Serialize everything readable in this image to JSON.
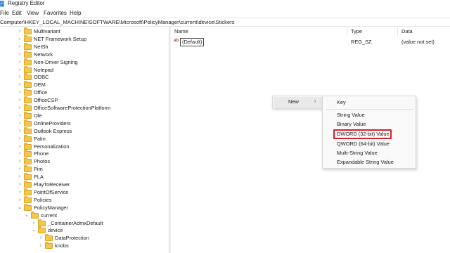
{
  "app": {
    "title": "Registry Editor"
  },
  "menu": [
    "File",
    "Edit",
    "View",
    "Favorites",
    "Help"
  ],
  "address": "Computer\\HKEY_LOCAL_MACHINE\\SOFTWARE\\Microsoft\\PolicyManager\\current\\device\\Stickers",
  "tree": [
    {
      "label": "Multivariant",
      "expanded": false
    },
    {
      "label": "NET Framework Setup",
      "expanded": false
    },
    {
      "label": "NetSh",
      "expanded": false
    },
    {
      "label": "Network",
      "expanded": false
    },
    {
      "label": "Non-Driver Signing",
      "expanded": false
    },
    {
      "label": "Notepad",
      "expanded": false
    },
    {
      "label": "ODBC",
      "expanded": false
    },
    {
      "label": "OEM",
      "expanded": false
    },
    {
      "label": "Office",
      "expanded": false
    },
    {
      "label": "OfficeCSP",
      "expanded": false
    },
    {
      "label": "OfficeSoftwareProtectionPlatform",
      "expanded": false
    },
    {
      "label": "Ole",
      "expanded": false
    },
    {
      "label": "OnlineProviders",
      "expanded": false
    },
    {
      "label": "Outlook Express",
      "expanded": false
    },
    {
      "label": "Palm",
      "expanded": false
    },
    {
      "label": "Personalization",
      "expanded": false
    },
    {
      "label": "Phone",
      "expanded": false
    },
    {
      "label": "Photos",
      "expanded": false
    },
    {
      "label": "Pim",
      "expanded": false
    },
    {
      "label": "PLA",
      "expanded": false
    },
    {
      "label": "PlayToReceiver",
      "expanded": false
    },
    {
      "label": "PointOfService",
      "expanded": false
    },
    {
      "label": "Policies",
      "expanded": false
    },
    {
      "label": "PolicyManager",
      "expanded": true
    },
    {
      "label": "current",
      "expanded": true
    },
    {
      "label": "_ContainerAdmxDefault",
      "expanded": false
    },
    {
      "label": "device",
      "expanded": true
    },
    {
      "label": "DataProtection",
      "expanded": false
    },
    {
      "label": "knobs",
      "expanded": false
    }
  ],
  "list": {
    "columns": [
      "Name",
      "Type",
      "Data"
    ],
    "rows": [
      {
        "icon": "ab",
        "name": "(Default)",
        "type": "REG_SZ",
        "data": "(value not set)"
      }
    ]
  },
  "context_menu": {
    "new_label": "New",
    "arrow": "›",
    "submenu": [
      "Key",
      "String Value",
      "Binary Value",
      "DWORD (32-bit) Value",
      "QWORD (64-bit) Value",
      "Multi-String Value",
      "Expandable String Value"
    ],
    "highlighted": "DWORD (32-bit) Value",
    "highlight_color": "#d6202a"
  }
}
